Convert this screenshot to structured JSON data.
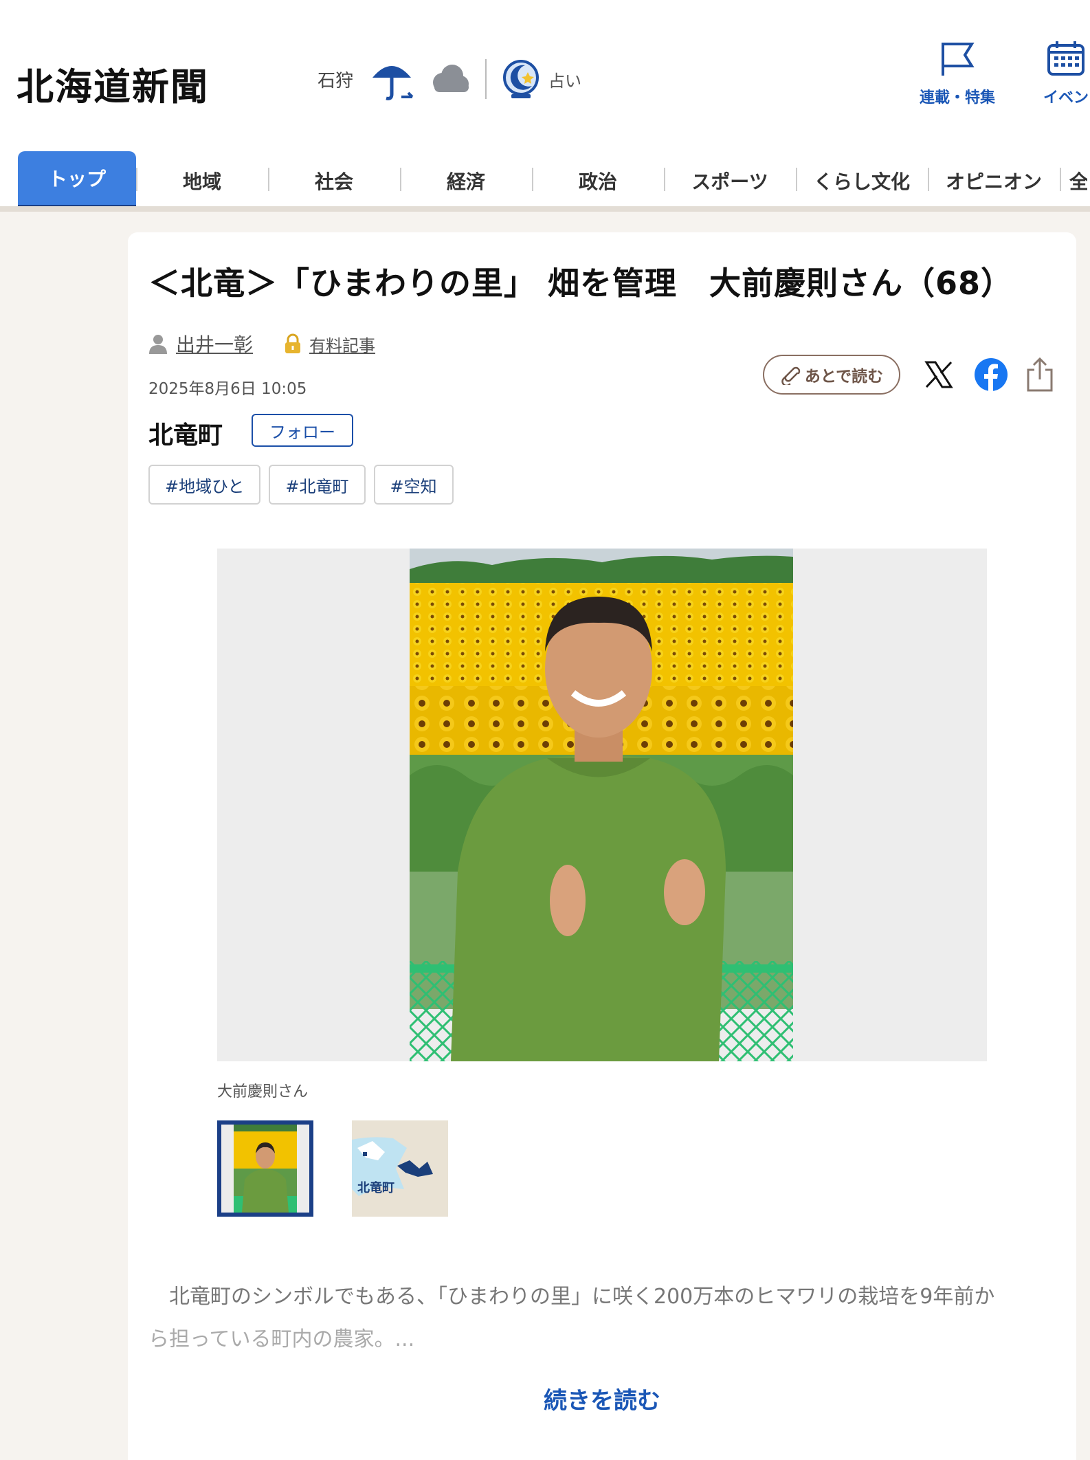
{
  "header": {
    "logo": "北海道新聞",
    "weather": {
      "location": "石狩",
      "icons": [
        "umbrella-icon",
        "cloud-icon"
      ]
    },
    "fortune_label": "占い",
    "top_links": [
      {
        "label": "連載・特集",
        "icon": "flag-icon"
      },
      {
        "label": "イベン",
        "icon": "calendar-icon"
      }
    ]
  },
  "nav": {
    "tabs": [
      {
        "label": "トップ",
        "active": true
      },
      {
        "label": "地域"
      },
      {
        "label": "社会"
      },
      {
        "label": "経済"
      },
      {
        "label": "政治"
      },
      {
        "label": "スポーツ"
      },
      {
        "label": "くらし文化"
      },
      {
        "label": "オピニオン"
      },
      {
        "label": "全"
      }
    ]
  },
  "article": {
    "title": "＜北竜＞「ひまわりの里」 畑を管理　大前慶則さん（68）",
    "author": "出井一彰",
    "paid_label": "有料記事",
    "date": "2025年8月6日 10:05",
    "region": "北竜町",
    "follow_label": "フォロー",
    "tags": [
      "#地域ひと",
      "#北竜町",
      "#空知"
    ],
    "read_later_label": "あとで読む",
    "caption": "大前慶則さん",
    "map_thumb_label": "北竜町",
    "lead_line1": "　北竜町のシンボルでもある、「ひまわりの里」に咲く200万本のヒマワリの栽培を9年前か",
    "lead_line2": "ら担っている町内の農家。...",
    "read_more_label": "続きを読む"
  },
  "colors": {
    "accent": "#3d7fe0",
    "accent_dark": "#1a3f87",
    "link": "#1b57b6"
  }
}
